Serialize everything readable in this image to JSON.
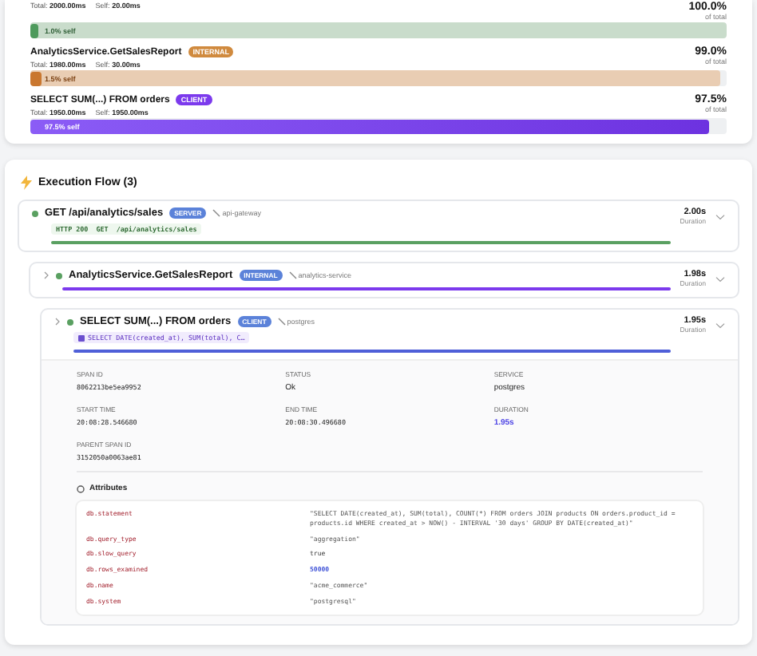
{
  "summary": {
    "rows": [
      {
        "total": "Total: **2000.00ms**",
        "self": "Self: **20.00ms**",
        "percent": "100.0%",
        "caption": "of total",
        "kind": "server",
        "bar": {
          "level": 1.0
        },
        "self_bar": {
          "level": 0.01
        },
        "self_label": "1.0% self"
      },
      {
        "name": "AnalyticsService.GetSalesReport",
        "badge": "INTERNAL",
        "kind": "internal",
        "total": "Total: **1980.00ms**",
        "self": "Self: **30.00ms**",
        "percent": "99.0%",
        "caption": "of total",
        "bar": {
          "level": 0.99
        },
        "self_bar": {
          "level": 0.015
        },
        "self_label": "1.5% self"
      },
      {
        "name": "SELECT SUM(...) FROM orders",
        "badge": "CLIENT",
        "kind": "client",
        "total": "Total: **1950.00ms**",
        "self": "Self: **1950.00ms**",
        "percent": "97.5%",
        "caption": "of total",
        "bar": {
          "level": 0.975
        },
        "self_bar": {
          "level": 0.975
        },
        "self_label": "97.5% self"
      }
    ]
  },
  "flow": {
    "title": "Execution Flow (3)",
    "spans": [
      {
        "name": "GET /api/analytics/sales",
        "badge": "SERVER",
        "service": "api-gateway",
        "duration": "2.00s",
        "caption": "Duration",
        "code": "HTTP 200  GET  /api/analytics/sales",
        "kind": "server",
        "expandable": false
      },
      {
        "name": "AnalyticsService.GetSalesReport",
        "badge": "INTERNAL",
        "service": "analytics-service",
        "duration": "1.98s",
        "caption": "Duration",
        "kind": "internal",
        "expandable": true
      },
      {
        "name": "SELECT SUM(...) FROM orders",
        "badge": "CLIENT",
        "service": "postgres",
        "duration": "1.95s",
        "caption": "Duration",
        "code": "SELECT DATE(created_at), SUM(total), C…",
        "kind": "client",
        "expandable": true,
        "details": {
          "fields": [
            {
              "label": "SPAN ID",
              "value": "8062213be5ea9952",
              "kind": "mono"
            },
            {
              "label": "STATUS",
              "value": "Ok",
              "kind": "text"
            },
            {
              "label": "SERVICE",
              "value": "postgres",
              "kind": "text"
            },
            {
              "label": "START TIME",
              "value": "20:08:28.546680",
              "kind": "mono"
            },
            {
              "label": "END TIME",
              "value": "20:08:30.496680",
              "kind": "mono"
            },
            {
              "label": "DURATION",
              "value": "1.95s",
              "kind": "accent"
            },
            {
              "label": "PARENT SPAN ID",
              "value": "3152050a0063ae81",
              "kind": "mono"
            }
          ],
          "attributes_title": "Attributes",
          "attributes": [
            {
              "key": "db.statement",
              "value": "\"SELECT DATE(created_at), SUM(total), COUNT(*) FROM orders JOIN products ON orders.product_id = products.id WHERE created_at > NOW() - INTERVAL '30 days' GROUP BY DATE(created_at)\"",
              "kind": "string"
            },
            {
              "key": "db.query_type",
              "value": "\"aggregation\"",
              "kind": "string"
            },
            {
              "key": "db.slow_query",
              "value": "true",
              "kind": "bool"
            },
            {
              "key": "db.rows_examined",
              "value": "50000",
              "kind": "number"
            },
            {
              "key": "db.name",
              "value": "\"acme_commerce\"",
              "kind": "string"
            },
            {
              "key": "db.system",
              "value": "\"postgresql\"",
              "kind": "string"
            }
          ]
        }
      }
    ]
  }
}
